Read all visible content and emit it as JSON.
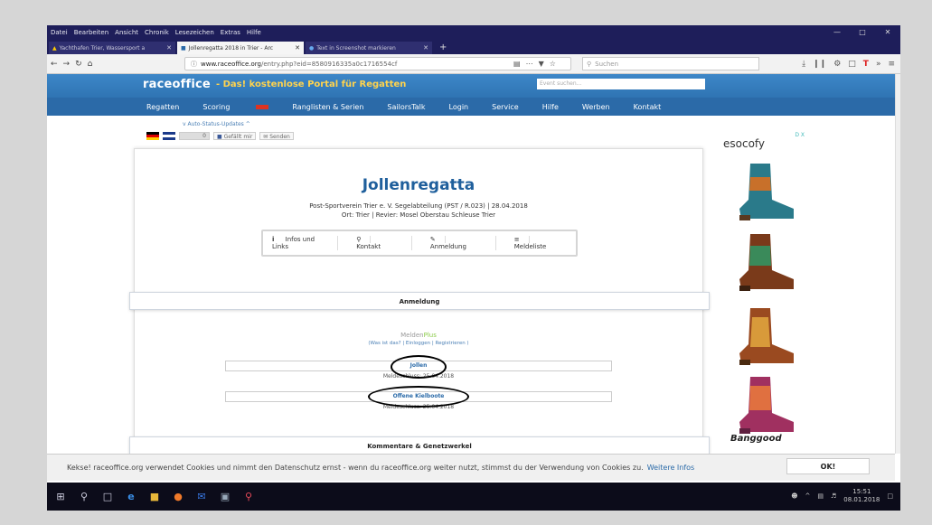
{
  "menubar": [
    "Datei",
    "Bearbeiten",
    "Ansicht",
    "Chronik",
    "Lesezeichen",
    "Extras",
    "Hilfe"
  ],
  "tabs": [
    {
      "label": "Yachthafen Trier, Wassersport a"
    },
    {
      "label": "Jollenregatta 2018 in Trier - Arc"
    },
    {
      "label": "Text in Screenshot markieren"
    }
  ],
  "url": {
    "host": "www.raceoffice.org",
    "path": "/entry.php?eid=8580916335a0c1716554cf"
  },
  "browser_search_placeholder": "Suchen",
  "site": {
    "logo": "raceoffice",
    "tagline": "- Das! kostenlose Portal für Regatten",
    "event_search_placeholder": "Event suchen...",
    "nav": [
      "Regatten",
      "Scoring",
      "Ranglisten & Serien",
      "SailorsTalk",
      "Login",
      "Service",
      "Hilfe",
      "Werben",
      "Kontakt"
    ]
  },
  "autostatus": "v Auto-Status-Updates ^",
  "social": {
    "like": "Gefällt mir",
    "send": "Senden",
    "toggle": "0"
  },
  "event": {
    "title": "Jollenregatta",
    "club_line": "Post-Sportverein Trier e. V. Segelabteilung (PST / R.023) | 28.04.2018",
    "location_line": "Ort: Trier | Revier: Mosel Oberstau Schleuse Trier",
    "tabs": [
      "Infos und Links",
      "Kontakt",
      "Anmeldung",
      "Meldeliste"
    ]
  },
  "anmeldung": {
    "header": "Anmeldung",
    "melden_plain": "Melden",
    "melden_plus": "Plus",
    "links": "(Was ist das? | Einloggen | Registrieren )",
    "entries": [
      {
        "label": "Jollen",
        "deadline": "Meldeschluss: 25.04.2018"
      },
      {
        "label": "Offene Kielboote",
        "deadline": "Meldeschluss: 25.04.2018"
      }
    ]
  },
  "comments_header": "Kommentare & Genetzwerkel",
  "ad": {
    "brand": "esocofy",
    "bottom_brand": "Banggood",
    "close": "D X"
  },
  "cookie": {
    "text": "Kekse! raceoffice.org verwendet Cookies und nimmt den Datenschutz ernst - wenn du raceoffice.org weiter nutzt, stimmst du der Verwendung von Cookies zu.",
    "link": "Weitere Infos",
    "ok": "OK!"
  },
  "clock": {
    "time": "15:51",
    "date": "08.01.2018"
  }
}
